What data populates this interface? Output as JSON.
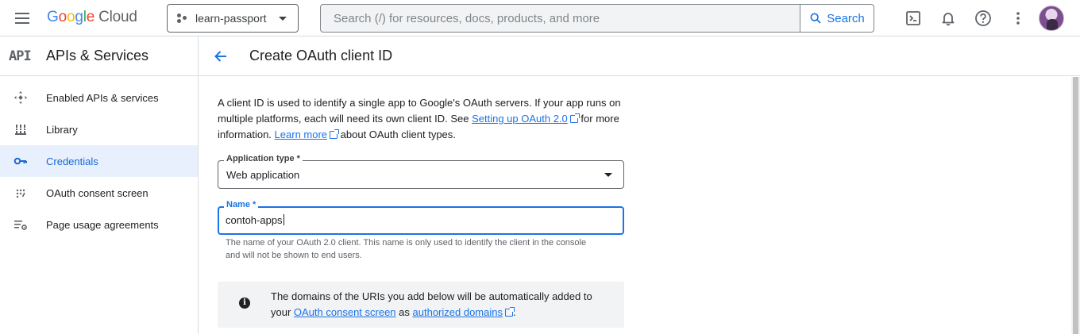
{
  "topbar": {
    "logo_letters": [
      "G",
      "o",
      "o",
      "g",
      "l",
      "e"
    ],
    "logo_product": "Cloud",
    "project_name": "learn-passport",
    "search_placeholder": "Search (/) for resources, docs, products, and more",
    "search_button": "Search",
    "icons": [
      "terminal-icon",
      "bell-icon",
      "help-icon",
      "more-vert-icon"
    ]
  },
  "sidebar": {
    "logo_mark": "API",
    "title": "APIs & Services",
    "items": [
      {
        "label": "Enabled APIs & services",
        "icon": "apis-icon",
        "active": false
      },
      {
        "label": "Library",
        "icon": "library-icon",
        "active": false
      },
      {
        "label": "Credentials",
        "icon": "key-icon",
        "active": true
      },
      {
        "label": "OAuth consent screen",
        "icon": "consent-icon",
        "active": false
      },
      {
        "label": "Page usage agreements",
        "icon": "settings-list-icon",
        "active": false
      }
    ]
  },
  "main": {
    "title": "Create OAuth client ID",
    "intro": {
      "part1": "A client ID is used to identify a single app to Google's OAuth servers. If your app runs on multiple platforms, each will need its own client ID. See ",
      "link1": "Setting up OAuth 2.0",
      "part2": " for more information. ",
      "link2": "Learn more",
      "part3": " about OAuth client types."
    },
    "app_type": {
      "label": "Application type *",
      "value": "Web application"
    },
    "name_field": {
      "label": "Name *",
      "value": "contoh-apps",
      "hint": "The name of your OAuth 2.0 client. This name is only used to identify the client in the console and will not be shown to end users."
    },
    "info_box": {
      "part1": "The domains of the URIs you add below will be automatically added to your ",
      "link1": "OAuth consent screen",
      "part2": " as ",
      "link2": "authorized domains",
      "part3": "."
    }
  },
  "colors": {
    "accent": "#1a73e8",
    "active_bg": "#e8f0fe",
    "text": "#202124",
    "muted": "#5f6368"
  }
}
